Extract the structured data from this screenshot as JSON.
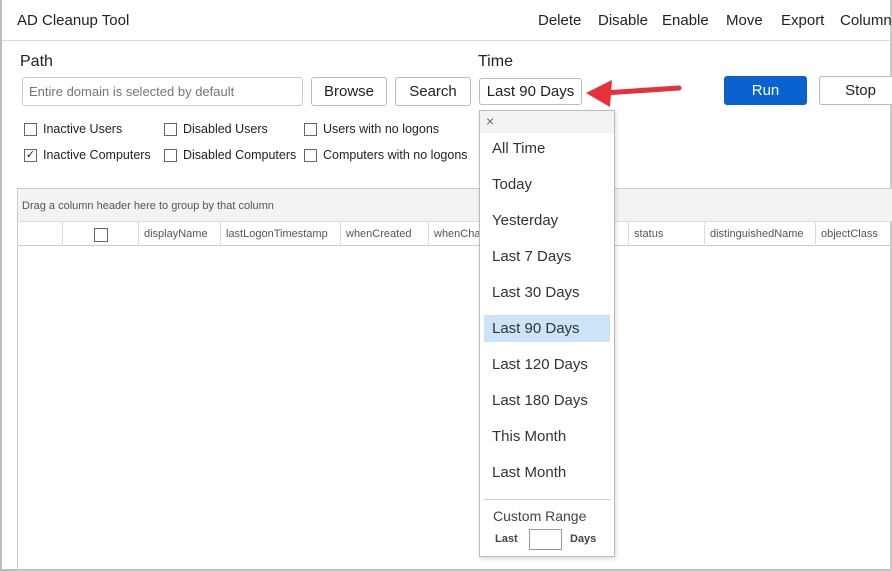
{
  "app": {
    "title": "AD Cleanup Tool"
  },
  "menu": [
    "Delete",
    "Disable",
    "Enable",
    "Move",
    "Export",
    "Columns"
  ],
  "path": {
    "label": "Path",
    "placeholder": "Entire domain is selected by default",
    "browse": "Browse",
    "search": "Search"
  },
  "time": {
    "label": "Time",
    "selected": "Last 90 Days"
  },
  "actions": {
    "run": "Run",
    "stop": "Stop"
  },
  "accent": "#0a62cf",
  "filters": [
    {
      "label": "Inactive Users",
      "checked": false
    },
    {
      "label": "Disabled Users",
      "checked": false
    },
    {
      "label": "Users with no logons",
      "checked": false
    },
    {
      "label": "Inactive Computers",
      "checked": true
    },
    {
      "label": "Disabled Computers",
      "checked": false
    },
    {
      "label": "Computers with no logons",
      "checked": false
    }
  ],
  "grid": {
    "group_hint": "Drag a column header here to group by that column",
    "columns": [
      "displayName",
      "lastLogonTimestamp",
      "whenCreated",
      "whenChanged",
      "status",
      "distinguishedName",
      "objectClass"
    ]
  },
  "dropdown": {
    "close": "×",
    "items": [
      "All Time",
      "Today",
      "Yesterday",
      "Last 7 Days",
      "Last 30 Days",
      "Last 90 Days",
      "Last 120 Days",
      "Last 180 Days",
      "This Month",
      "Last Month"
    ],
    "custom_label": "Custom Range",
    "last": "Last",
    "days": "Days",
    "days_value": ""
  }
}
